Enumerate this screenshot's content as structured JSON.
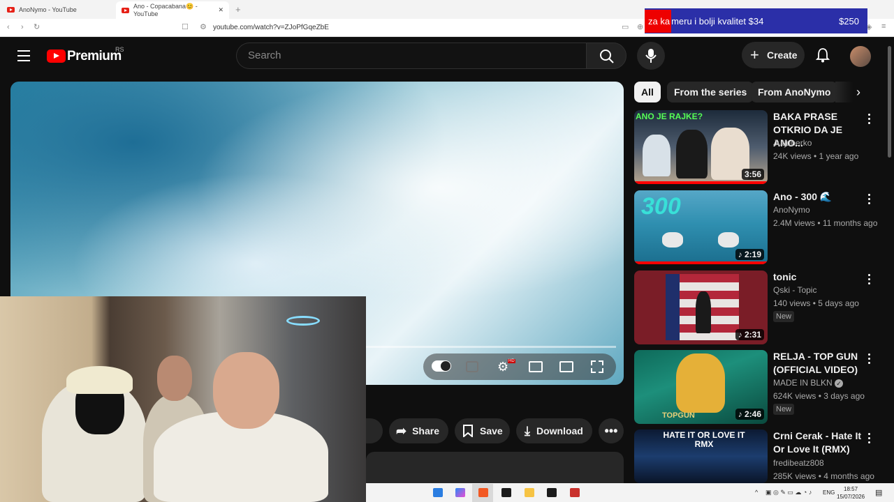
{
  "browser": {
    "tabs": [
      {
        "label": "AnoNymo - YouTube",
        "active": false
      },
      {
        "label": "Ano - Copacabana😊 - YouTube",
        "active": true
      }
    ],
    "url": "youtube.com/watch?v=ZJoPfGqeZbE",
    "new_tab_symbol": "+",
    "close_symbol": "✕"
  },
  "ad_banner": {
    "prefix": "za ka",
    "text": "meru i bolji kvalitet $34",
    "price": "$250"
  },
  "header": {
    "logo_text": "Premium",
    "region": "RS",
    "search_placeholder": "Search",
    "create_label": "Create"
  },
  "actions": {
    "share": "Share",
    "save": "Save",
    "download": "Download"
  },
  "chips": [
    "All",
    "From the series",
    "From AnoNymo"
  ],
  "recommendations": [
    {
      "title": "BAKA PRASE OTKRIO DA JE ANO...",
      "channel": "Jutjuberko",
      "meta": "24K views • 1 year ago",
      "duration": "3:56",
      "badge": "",
      "thumb_caption": "ANO JE RAJKE?"
    },
    {
      "title": "Ano - 300 🌊",
      "channel": "AnoNymo",
      "meta": "2.4M views • 11 months ago",
      "duration": "2:19",
      "badge": "",
      "thumb_caption": ""
    },
    {
      "title": "tonic",
      "channel": "Qski - Topic",
      "meta": "140 views • 5 days ago",
      "duration": "2:31",
      "badge": "New",
      "thumb_caption": ""
    },
    {
      "title": "RELJA - TOP GUN (OFFICIAL VIDEO)",
      "channel": "MADE IN BLKN",
      "meta": "624K views • 3 days ago",
      "duration": "2:46",
      "badge": "New",
      "thumb_caption": "TOPGUN"
    },
    {
      "title": "Crni Cerak - Hate It Or Love It (RMX)",
      "channel": "fredibeatz808",
      "meta": "285K views • 4 months ago",
      "duration": "",
      "badge": "",
      "thumb_caption": "HATE IT OR LOVE IT RMX"
    }
  ],
  "taskbar": {
    "lang": "ENG",
    "time": "18:57",
    "date": "15/07/2026"
  }
}
